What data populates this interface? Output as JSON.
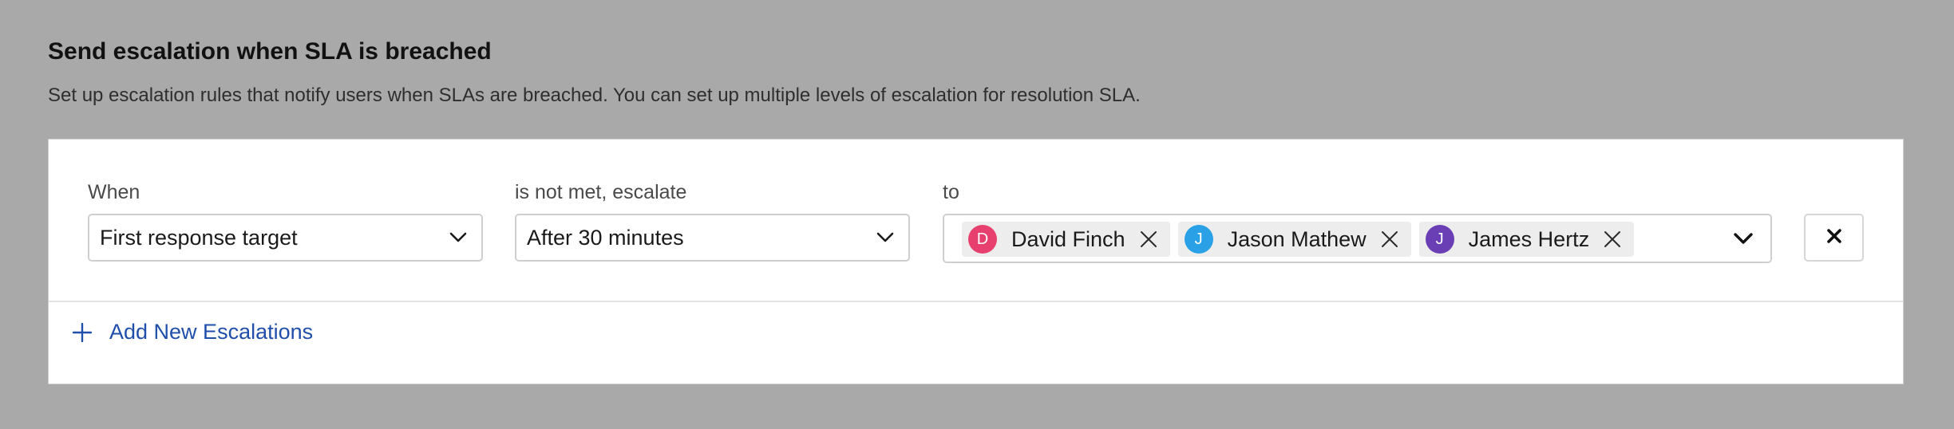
{
  "section": {
    "title": "Send escalation when SLA is breached",
    "description": "Set up escalation rules that notify users when SLAs are breached. You can set up multiple levels of escalation for resolution SLA."
  },
  "rule": {
    "when_label": "When",
    "when_value": "First response target",
    "escalate_label": "is not met, escalate",
    "escalate_value": "After 30 minutes",
    "to_label": "to",
    "recipients": [
      {
        "initial": "D",
        "name": "David Finch",
        "color": "#e8406e"
      },
      {
        "initial": "J",
        "name": "Jason Mathew",
        "color": "#2aa0e6"
      },
      {
        "initial": "J",
        "name": "James Hertz",
        "color": "#6a3fb5"
      }
    ],
    "icons": {
      "dropdown": "chevron-down-icon",
      "remove_chip": "close-icon",
      "remove_rule": "close-icon"
    }
  },
  "actions": {
    "add_label": "Add New Escalations",
    "add_icon": "plus-icon",
    "add_color": "#1f4faa"
  }
}
